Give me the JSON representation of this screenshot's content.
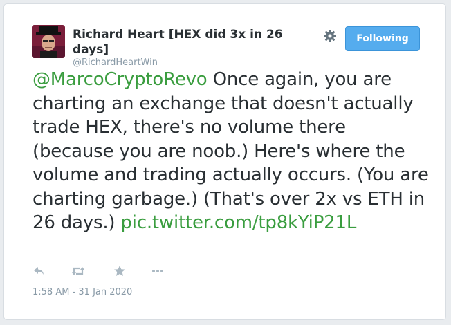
{
  "user": {
    "display_name": "Richard Heart [HEX did 3x in 26 days]",
    "handle": "@RichardHeartWin"
  },
  "follow_button": {
    "label": "Following"
  },
  "tweet": {
    "mention": "@MarcoCryptoRevo",
    "body": " Once again, you are charting an exchange that doesn't actually trade HEX, there's no volume there (because you are noob.) Here's where the volume and trading actually occurs. (You are charting garbage.) (That's over 2x vs ETH in 26 days.) ",
    "media_link": "pic.twitter.com/tp8kYiP21L"
  },
  "actions": [
    {
      "icon": "reply-icon"
    },
    {
      "icon": "retweet-icon"
    },
    {
      "icon": "favorite-icon"
    },
    {
      "icon": "more-icon"
    }
  ],
  "timestamp": "1:58 AM - 31 Jan 2020",
  "colors": {
    "link": "#3a9d3f",
    "follow_button": "#55acee",
    "text": "#292f33",
    "muted": "#8899a6",
    "icon": "#aab8c2"
  }
}
